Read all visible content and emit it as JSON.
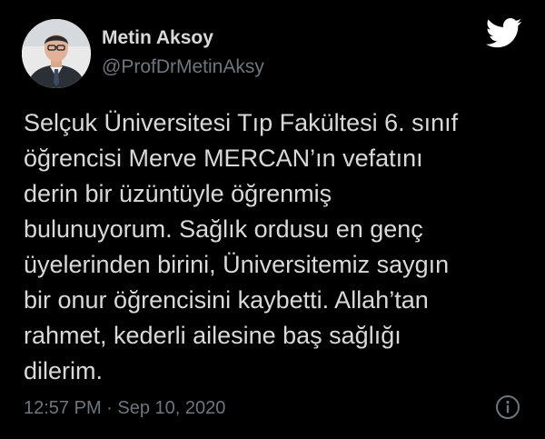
{
  "tweet": {
    "author_name": "Metin Aksoy",
    "author_handle": "@ProfDrMetinAksy",
    "text_lines": [
      "Selçuk Üniversitesi Tıp Fakültesi 6. sınıf",
      "öğrencisi Merve MERCAN’ın vefatını",
      "derin bir üzüntüyle öğrenmiş",
      "bulunuyorum. Sağlık ordusu en genç",
      "üyelerinden birini, Üniversitemiz saygın",
      "bir onur öğrencisini kaybetti. Allah’tan",
      "rahmet, kederli ailesine baş sağlığı",
      "dilerim."
    ],
    "timestamp": "12:57 PM · Sep 10, 2020"
  },
  "icons": {
    "brand": "twitter-bird-icon",
    "info": "info-icon"
  },
  "colors": {
    "background": "#000000",
    "text_primary": "#d9d9d9",
    "text_secondary": "#6e767d",
    "brand": "#ffffff"
  }
}
